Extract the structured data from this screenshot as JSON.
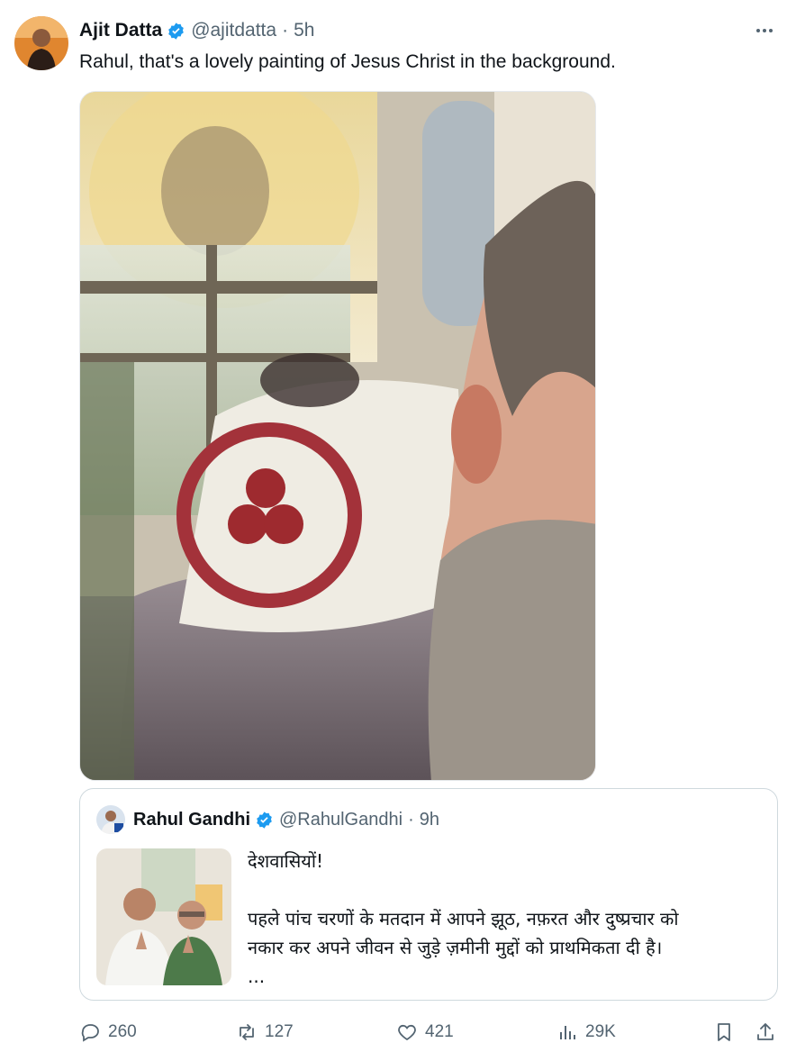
{
  "author": {
    "name": "Ajit Datta",
    "handle": "@ajitdatta",
    "separator": "·",
    "time": "5h",
    "verified": true
  },
  "more_icon": "more-dots-icon",
  "tweet": {
    "text": "Rahul, that's a lovely painting of Jesus Christ in the background."
  },
  "quoted": {
    "name": "Rahul Gandhi",
    "handle": "@RahulGandhi",
    "separator": "·",
    "time": "9h",
    "verified": true,
    "lines": [
      "देशवासियों!",
      "पहले पांच चरणों के मतदान में आपने झूठ, नफ़रत और दुष्प्रचार को",
      "नकार कर अपने जीवन से जुड़े ज़मीनी मुद्दों को प्राथमिकता दी है।",
      "..."
    ]
  },
  "actions": {
    "replies": "260",
    "reposts": "127",
    "likes": "421",
    "views": "29K"
  },
  "colors": {
    "verified": "#1d9bf0",
    "muted": "#536471",
    "border": "#cfd9de"
  }
}
